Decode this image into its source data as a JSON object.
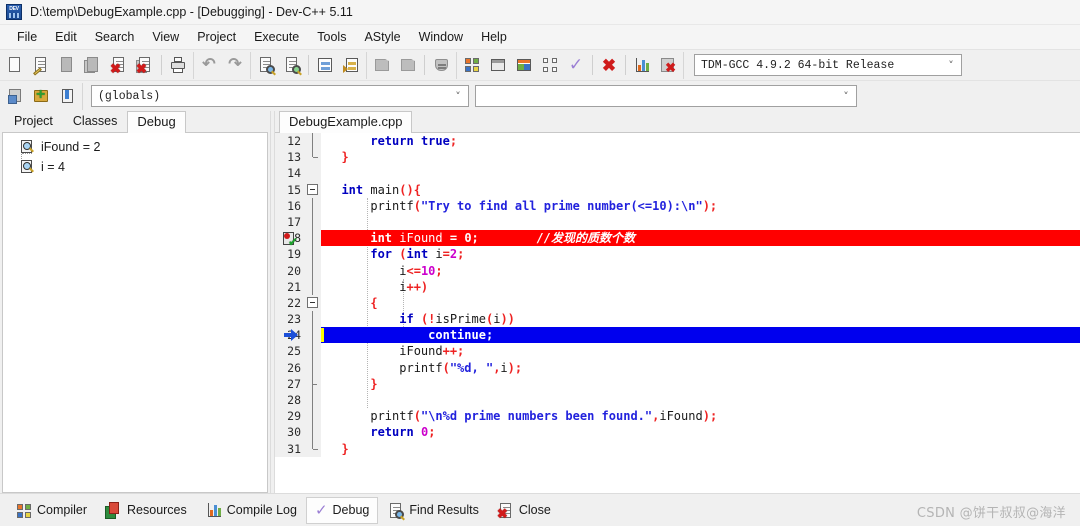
{
  "window": {
    "title": "D:\\temp\\DebugExample.cpp - [Debugging] - Dev-C++ 5.11",
    "app_icon": "dev-cpp-icon"
  },
  "menubar": {
    "items": [
      {
        "label": "File"
      },
      {
        "label": "Edit"
      },
      {
        "label": "Search"
      },
      {
        "label": "View"
      },
      {
        "label": "Project"
      },
      {
        "label": "Execute"
      },
      {
        "label": "Tools"
      },
      {
        "label": "AStyle"
      },
      {
        "label": "Window"
      },
      {
        "label": "Help"
      }
    ]
  },
  "toolbar": {
    "row1": [
      {
        "name": "new-file-icon"
      },
      {
        "name": "open-file-icon"
      },
      {
        "name": "save-file-icon"
      },
      {
        "name": "save-all-icon"
      },
      {
        "name": "close-file-icon"
      },
      {
        "name": "close-all-icon"
      },
      {
        "name": "print-icon"
      },
      {
        "name": "undo-icon"
      },
      {
        "name": "redo-icon"
      },
      {
        "name": "find-icon"
      },
      {
        "name": "replace-icon"
      },
      {
        "name": "goto-function-icon"
      },
      {
        "name": "goto-line-icon"
      },
      {
        "name": "prev-bookmark-icon"
      },
      {
        "name": "next-bookmark-icon"
      },
      {
        "name": "toggle-bookmark-icon"
      },
      {
        "name": "compile-icon"
      },
      {
        "name": "run-icon"
      },
      {
        "name": "compile-run-icon"
      },
      {
        "name": "rebuild-all-icon"
      },
      {
        "name": "syntax-check-icon"
      },
      {
        "name": "stop-execution-icon"
      },
      {
        "name": "profile-icon"
      },
      {
        "name": "delete-profile-icon"
      }
    ],
    "row2": [
      {
        "name": "new-project-icon"
      },
      {
        "name": "add-to-project-icon"
      },
      {
        "name": "remove-from-project-icon"
      }
    ],
    "compiler_set": {
      "value": "TDM-GCC 4.9.2 64-bit Release",
      "caret": "chevron-down-icon"
    },
    "scope_combo": {
      "value": "(globals)",
      "caret": "chevron-down-icon"
    },
    "member_combo": {
      "value": "",
      "caret": "chevron-down-icon"
    }
  },
  "left_panel": {
    "tabs": [
      {
        "label": "Project",
        "active": false
      },
      {
        "label": "Classes",
        "active": false
      },
      {
        "label": "Debug",
        "active": true
      }
    ],
    "watches": [
      {
        "icon": "watch-variable-icon",
        "text": "iFound = 2"
      },
      {
        "icon": "watch-variable-icon",
        "text": "i = 4"
      }
    ]
  },
  "editor": {
    "tabs": [
      {
        "label": "DebugExample.cpp",
        "active": true
      }
    ],
    "lines": [
      {
        "number": "12",
        "fold": "half-bot-end",
        "state": "normal",
        "tokens": [
          {
            "t": "      ",
            "c": "id"
          },
          {
            "t": "return",
            "c": "kw"
          },
          {
            "t": " ",
            "c": "id"
          },
          {
            "t": "true",
            "c": "kw"
          },
          {
            "t": ";",
            "c": "pun"
          }
        ]
      },
      {
        "number": "13",
        "fold": "end",
        "state": "normal",
        "tokens": [
          {
            "t": "  ",
            "c": "id"
          },
          {
            "t": "}",
            "c": "pun"
          }
        ]
      },
      {
        "number": "14",
        "fold": "none",
        "state": "normal",
        "tokens": []
      },
      {
        "number": "15",
        "fold": "box",
        "state": "normal",
        "tokens": [
          {
            "t": "  ",
            "c": "id"
          },
          {
            "t": "int",
            "c": "kw"
          },
          {
            "t": " main",
            "c": "id"
          },
          {
            "t": "(){",
            "c": "pun"
          }
        ]
      },
      {
        "number": "16",
        "fold": "line",
        "state": "normal",
        "tokens": [
          {
            "t": "      printf",
            "c": "id"
          },
          {
            "t": "(",
            "c": "pun"
          },
          {
            "t": "\"Try to find all prime number(<=10):\\n\"",
            "c": "str"
          },
          {
            "t": ");",
            "c": "pun"
          }
        ]
      },
      {
        "number": "17",
        "fold": "line",
        "state": "normal",
        "tokens": []
      },
      {
        "number": "18",
        "fold": "line",
        "state": "breakpoint",
        "marker": "breakpoint-active-icon",
        "tokens": [
          {
            "t": "      ",
            "c": "id"
          },
          {
            "t": "int",
            "c": "kw"
          },
          {
            "t": " iFound ",
            "c": "id"
          },
          {
            "t": "=",
            "c": "pun"
          },
          {
            "t": " ",
            "c": "id"
          },
          {
            "t": "0",
            "c": "num"
          },
          {
            "t": ";",
            "c": "pun"
          },
          {
            "t": "        ",
            "c": "id"
          },
          {
            "t": "//发现的质数个数",
            "c": "cmt"
          }
        ]
      },
      {
        "number": "19",
        "fold": "line",
        "state": "normal",
        "tokens": [
          {
            "t": "      ",
            "c": "id"
          },
          {
            "t": "for",
            "c": "kw"
          },
          {
            "t": " ",
            "c": "id"
          },
          {
            "t": "(",
            "c": "pun"
          },
          {
            "t": "int",
            "c": "kw"
          },
          {
            "t": " i",
            "c": "id"
          },
          {
            "t": "=",
            "c": "pun"
          },
          {
            "t": "2",
            "c": "num"
          },
          {
            "t": ";",
            "c": "pun"
          }
        ]
      },
      {
        "number": "20",
        "fold": "line",
        "state": "normal",
        "tokens": [
          {
            "t": "          i",
            "c": "id"
          },
          {
            "t": "<=",
            "c": "pun"
          },
          {
            "t": "10",
            "c": "num"
          },
          {
            "t": ";",
            "c": "pun"
          }
        ]
      },
      {
        "number": "21",
        "fold": "line",
        "state": "normal",
        "tokens": [
          {
            "t": "          i",
            "c": "id"
          },
          {
            "t": "++)",
            "c": "pun"
          }
        ]
      },
      {
        "number": "22",
        "fold": "box",
        "state": "normal",
        "tokens": [
          {
            "t": "      ",
            "c": "id"
          },
          {
            "t": "{",
            "c": "pun"
          }
        ]
      },
      {
        "number": "23",
        "fold": "line",
        "state": "normal",
        "tokens": [
          {
            "t": "          ",
            "c": "id"
          },
          {
            "t": "if",
            "c": "kw"
          },
          {
            "t": " ",
            "c": "id"
          },
          {
            "t": "(!",
            "c": "pun"
          },
          {
            "t": "isPrime",
            "c": "id"
          },
          {
            "t": "(",
            "c": "pun"
          },
          {
            "t": "i",
            "c": "id"
          },
          {
            "t": "))",
            "c": "pun"
          }
        ]
      },
      {
        "number": "24",
        "fold": "line",
        "state": "current",
        "marker": "execution-arrow-icon",
        "tokens": [
          {
            "t": "              ",
            "c": "id"
          },
          {
            "t": "continue",
            "c": "kw"
          },
          {
            "t": ";",
            "c": "pun"
          }
        ]
      },
      {
        "number": "25",
        "fold": "line",
        "state": "normal",
        "tokens": [
          {
            "t": "          iFound",
            "c": "id"
          },
          {
            "t": "++;",
            "c": "pun"
          }
        ]
      },
      {
        "number": "26",
        "fold": "line",
        "state": "normal",
        "tokens": [
          {
            "t": "          printf",
            "c": "id"
          },
          {
            "t": "(",
            "c": "pun"
          },
          {
            "t": "\"%d, \"",
            "c": "str"
          },
          {
            "t": ",",
            "c": "pun"
          },
          {
            "t": "i",
            "c": "id"
          },
          {
            "t": ");",
            "c": "pun"
          }
        ]
      },
      {
        "number": "27",
        "fold": "mid",
        "state": "normal",
        "tokens": [
          {
            "t": "      ",
            "c": "id"
          },
          {
            "t": "}",
            "c": "pun"
          }
        ]
      },
      {
        "number": "28",
        "fold": "line",
        "state": "normal",
        "tokens": []
      },
      {
        "number": "29",
        "fold": "line",
        "state": "normal",
        "tokens": [
          {
            "t": "      printf",
            "c": "id"
          },
          {
            "t": "(",
            "c": "pun"
          },
          {
            "t": "\"\\n%d prime numbers been found.\"",
            "c": "str"
          },
          {
            "t": ",",
            "c": "pun"
          },
          {
            "t": "iFound",
            "c": "id"
          },
          {
            "t": ");",
            "c": "pun"
          }
        ]
      },
      {
        "number": "30",
        "fold": "line",
        "state": "normal",
        "tokens": [
          {
            "t": "      ",
            "c": "id"
          },
          {
            "t": "return",
            "c": "kw"
          },
          {
            "t": " ",
            "c": "id"
          },
          {
            "t": "0",
            "c": "num"
          },
          {
            "t": ";",
            "c": "pun"
          }
        ]
      },
      {
        "number": "31",
        "fold": "end",
        "state": "normal",
        "tokens": [
          {
            "t": "  ",
            "c": "id"
          },
          {
            "t": "}",
            "c": "pun"
          }
        ]
      }
    ]
  },
  "bottom_bar": {
    "tabs": [
      {
        "label": "Compiler",
        "icon": "compiler-icon",
        "active": false
      },
      {
        "label": "Resources",
        "icon": "resources-icon",
        "active": false
      },
      {
        "label": "Compile Log",
        "icon": "compile-log-icon",
        "active": false
      },
      {
        "label": "Debug",
        "icon": "debug-check-icon",
        "active": true
      },
      {
        "label": "Find Results",
        "icon": "find-results-icon",
        "active": false
      },
      {
        "label": "Close",
        "icon": "close-x-icon",
        "active": false
      }
    ],
    "watermark": "CSDN @饼干叔叔@海洋"
  },
  "colors": {
    "breakpoint_line": "#ff0000",
    "current_line": "#0000ee",
    "keyword": "#0000c0",
    "string": "#2222dd",
    "number": "#cc00cc",
    "punctuation": "#ee2222",
    "window_bg": "#f0f0f0"
  }
}
